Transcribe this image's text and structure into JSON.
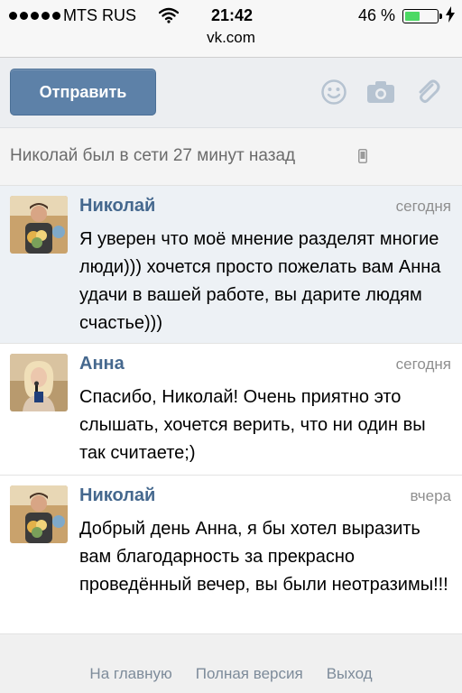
{
  "status_bar": {
    "carrier": "MTS RUS",
    "time": "21:42",
    "battery_percent": "46 %",
    "battery_level": 0.46,
    "url": "vk.com"
  },
  "composer": {
    "send_label": "Отправить",
    "icons": [
      "smile-icon",
      "camera-icon",
      "paperclip-icon"
    ]
  },
  "last_seen": {
    "text": "Николай был в сети 27 минут назад",
    "icon": "mobile-phone-icon"
  },
  "messages": [
    {
      "author": "Николай",
      "time": "сегодня",
      "text": "Я уверен что моё мнение разделят многие люди))) хочется просто пожелать вам Анна удачи в вашей работе, вы дарите людям счастье)))",
      "unread": true
    },
    {
      "author": "Анна",
      "time": "сегодня",
      "text": "Спасибо, Николай! Очень приятно это слышать, хочется верить, что ни один вы так считаете;)",
      "unread": false
    },
    {
      "author": "Николай",
      "time": "вчера",
      "text": "Добрый день Анна, я бы хотел выразить вам благодарность за прекрасно проведённый вечер, вы были неотразимы!!!",
      "unread": false
    }
  ],
  "footer": {
    "links": [
      "На главную",
      "Полная версия",
      "Выход"
    ]
  },
  "colors": {
    "accent": "#5d81a8",
    "author": "#45688e",
    "unread_bg": "#edf1f5"
  }
}
